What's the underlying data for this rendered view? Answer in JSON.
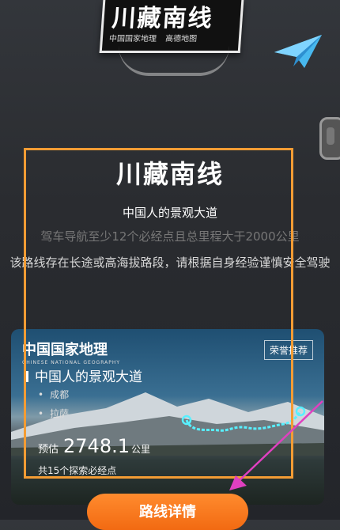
{
  "logo": {
    "title": "川藏南线",
    "partners": [
      "中国国家地理",
      "高德地图"
    ]
  },
  "main": {
    "title": "川藏南线",
    "subtitle": "中国人的景观大道",
    "description": "驾车导航至少12个必经点且总里程大于2000公里",
    "warning": "该路线存在长途或高海拔路段，请根据自身经验谨慎安全驾驶"
  },
  "card": {
    "brand": "中国国家地理",
    "brand_en": "CHINESE NATIONAL GEOGRAPHY",
    "badge": "荣誉推荐",
    "route_name": "中国人的景观大道",
    "stops": [
      "成都",
      "拉萨"
    ],
    "estimate_label": "预估",
    "distance": "2748.1",
    "distance_unit": "公里",
    "checkpoint_text": "共15个探索必经点"
  },
  "button": {
    "label": "路线详情"
  },
  "colors": {
    "accent": "#f26a12",
    "highlight_box": "#f39c34",
    "annotation_arrow": "#e040c0",
    "route_line": "#58f0ff"
  },
  "icons": [
    "paper-plane-icon",
    "side-handle-icon"
  ]
}
